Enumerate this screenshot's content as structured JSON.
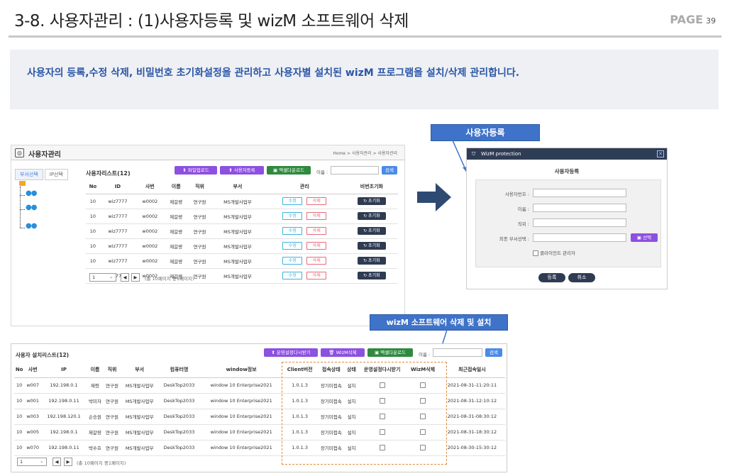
{
  "header": {
    "title": "3-8. 사용자관리 : (1)사용자등록 및 wizM 소프트웨어 삭제",
    "page_label": "PAGE",
    "page_num": "39"
  },
  "banner": {
    "text": "사용자의 등록,수정 삭제, 비밀번호 초기화설정을 관리하고 사용자별 설치된 wizM 프로그램을 설치/삭제 관리합니다."
  },
  "user_panel": {
    "title": "사용자관리",
    "breadcrumb": "Home > 사용자관리 > 사용자관리",
    "tab_dept": "부서선택",
    "tab_ip": "IP선택",
    "list_label": "사용자리스트(12)",
    "btn_upload": "파일업로드",
    "btn_register": "사용자등록",
    "btn_excel": "엑셀다운로드",
    "name_label": "이름 :",
    "btn_search": "검색",
    "columns": [
      "No",
      "ID",
      "사번",
      "이름",
      "직위",
      "부서",
      "관리",
      "비번초기화"
    ],
    "rows": [
      [
        "10",
        "wiz7777",
        "w0002",
        "제갈량",
        "연구원",
        "MS개발사업부"
      ],
      [
        "10",
        "wiz7777",
        "w0002",
        "제갈량",
        "연구원",
        "MS개발사업부"
      ],
      [
        "10",
        "wiz7777",
        "w0002",
        "제갈량",
        "연구원",
        "MS개발사업부"
      ],
      [
        "10",
        "wiz7777",
        "w0002",
        "제갈량",
        "연구원",
        "MS개발사업부"
      ],
      [
        "10",
        "wiz7777",
        "w0002",
        "제갈량",
        "연구원",
        "MS개발사업부"
      ],
      [
        "10",
        "wiz7777",
        "w0002",
        "제갈량",
        "연구원",
        "MS개발사업부"
      ]
    ],
    "edit_label": "수정",
    "delete_label": "삭제",
    "reset_label": "초기화",
    "pager_value": "1",
    "pager_info": "(총 10페이지 중1페이지)"
  },
  "callout_register": "사용자등록",
  "dialog": {
    "header": "WizM protection",
    "title": "사용자등록",
    "f_no": "사용자번호 :",
    "f_name": "이름 :",
    "f_pos": "직위 :",
    "f_dept": "최종 부서선택 :",
    "btn_select": "선택",
    "cb_label": "클라이언트 관리자",
    "btn_ok": "등록",
    "btn_cancel": "취소"
  },
  "callout_install": "wizM 소프트웨어 삭제 및 설치",
  "install_panel": {
    "list_label": "사용자 설치리스트(12)",
    "btn_receive": "운영설정다시받기",
    "btn_wizm_delete": "WizM삭제",
    "btn_excel": "엑셀다운로드",
    "name_label": "이름 :",
    "btn_search": "검색",
    "columns": [
      "No",
      "사번",
      "IP",
      "이름",
      "직위",
      "부서",
      "컴퓨터명",
      "window정보",
      "Client버전",
      "접속상태",
      "상태",
      "운영설정다시받기",
      "WizM삭제",
      "최근접속일시"
    ],
    "rows": [
      [
        "10",
        "w007",
        "192.198.0.1",
        "제령",
        "연구원",
        "MS개발사업부",
        "DeskTop2033",
        "window 10 Enterprise2021",
        "1.0.1.3",
        "장기미접속",
        "설치",
        "2021-08-31-11:20:11"
      ],
      [
        "10",
        "w001",
        "192.198.0.11",
        "박미자",
        "연구원",
        "MS개발사업부",
        "DeskTop2033",
        "window 10 Enterprise2021",
        "1.0.1.3",
        "장기미접속",
        "설치",
        "2021-08-31-12:10:12"
      ],
      [
        "10",
        "w003",
        "192.198.120.1",
        "손승원",
        "연구원",
        "MS개발사업부",
        "DeskTop2033",
        "window 10 Enterprise2021",
        "1.0.1.3",
        "장기미접속",
        "설치",
        "2021-08-31-08:30:12"
      ],
      [
        "10",
        "w005",
        "192.198.0.1",
        "제갈량",
        "연구원",
        "MS개발사업부",
        "DeskTop2033",
        "window 10 Enterprise2021",
        "1.0.1.3",
        "장기미접속",
        "설치",
        "2021-08-31-18:30:12"
      ],
      [
        "10",
        "w070",
        "192.198.0.11",
        "박수호",
        "연구원",
        "MS개발사업부",
        "DeskTop2033",
        "window 10 Enterprise2021",
        "1.0.1.3",
        "장기미접속",
        "설치",
        "2021-08-30-15:30:12"
      ]
    ],
    "pager_value": "1",
    "pager_info": "(총 10페이지 중1페이지)"
  },
  "colors": {
    "accent": "#2b56a6",
    "purple": "#8d50e0",
    "green": "#2f8a3e",
    "navy": "#2e3b52",
    "dash": "#e08a3c"
  }
}
